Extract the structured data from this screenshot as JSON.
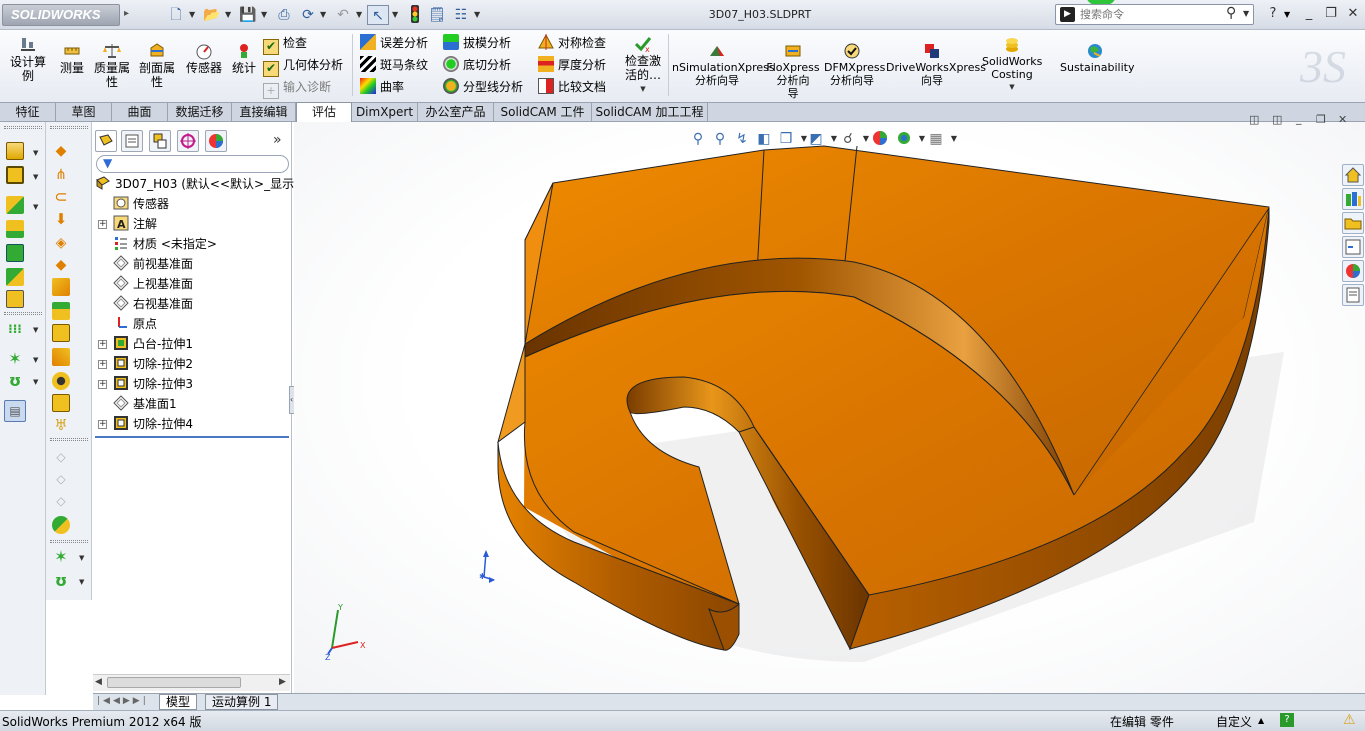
{
  "app": {
    "logo": "SOLIDWORKS",
    "filename": "3D07_H03.SLDPRT"
  },
  "search": {
    "placeholder": "搜索命令"
  },
  "ribbon": {
    "big_buttons": [
      {
        "label": "设计算\n例"
      },
      {
        "label": "测量"
      },
      {
        "label": "质量属\n性"
      },
      {
        "label": "剖面属\n性"
      },
      {
        "label": "传感器"
      },
      {
        "label": "统计"
      }
    ],
    "check_group": [
      "检查",
      "几何体分析",
      "输入诊断"
    ],
    "analysis_col1": [
      "误差分析",
      "斑马条纹",
      "曲率"
    ],
    "analysis_col2": [
      "拔模分析",
      "底切分析",
      "分型线分析"
    ],
    "analysis_col3": [
      "对称检查",
      "厚度分析",
      "比较文档"
    ],
    "check_active": "检查激\n活的…",
    "xpress": [
      {
        "label": "nSimulationXpress\n分析向导"
      },
      {
        "label": "FloXpress\n分析向\n导"
      },
      {
        "label": "DFMXpress\n分析向导"
      },
      {
        "label": "DriveWorksXpress\n向导"
      },
      {
        "label": "SolidWorks\nCosting"
      },
      {
        "label": "Sustainability"
      }
    ]
  },
  "tabs": [
    "特征",
    "草图",
    "曲面",
    "数据迁移",
    "直接编辑",
    "评估",
    "DimXpert",
    "办公室产品",
    "SolidCAM 工件",
    "SolidCAM 加工工程"
  ],
  "active_tab": "评估",
  "tree": {
    "root": "3D07_H03  (默认<<默认>_显示",
    "nodes": [
      {
        "label": "传感器",
        "icon": "sensor-icon",
        "expandable": false
      },
      {
        "label": "注解",
        "icon": "annotation-icon",
        "expandable": true
      },
      {
        "label": "材质 <未指定>",
        "icon": "material-icon",
        "expandable": false
      },
      {
        "label": "前视基准面",
        "icon": "plane-icon",
        "expandable": false
      },
      {
        "label": "上视基准面",
        "icon": "plane-icon",
        "expandable": false
      },
      {
        "label": "右视基准面",
        "icon": "plane-icon",
        "expandable": false
      },
      {
        "label": "原点",
        "icon": "origin-icon",
        "expandable": false
      },
      {
        "label": "凸台-拉伸1",
        "icon": "boss-extrude-icon",
        "expandable": true
      },
      {
        "label": "切除-拉伸2",
        "icon": "cut-extrude-icon",
        "expandable": true
      },
      {
        "label": "切除-拉伸3",
        "icon": "cut-extrude-icon",
        "expandable": true
      },
      {
        "label": "基准面1",
        "icon": "plane-icon",
        "expandable": false
      },
      {
        "label": "切除-拉伸4",
        "icon": "cut-extrude-icon",
        "expandable": true
      }
    ]
  },
  "bottom_tabs": [
    "模型",
    "运动算例 1"
  ],
  "status": {
    "left": "SolidWorks Premium 2012 x64 版",
    "editing": "在编辑 零件",
    "units": "自定义"
  },
  "colors": {
    "part_orange": "#e07a00",
    "part_dark": "#8a4700",
    "ribbon_bg": "#eef1f6"
  }
}
